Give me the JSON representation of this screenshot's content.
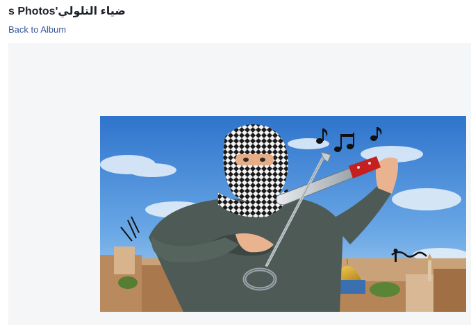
{
  "header": {
    "title": "ضياء التلولي's Photos",
    "back_label": "Back to Album"
  },
  "photo": {
    "subject": "cartoon of a masked man in a keffiyeh playing a knife like a violin with a key as the bow, Dome of the Rock in background",
    "icons": [
      "music-notes",
      "key",
      "knife",
      "artist-signature"
    ]
  },
  "colors": {
    "link": "#365899",
    "title": "#1d2129",
    "stage_bg": "#f5f6f7",
    "sky": "#3f86d6"
  }
}
